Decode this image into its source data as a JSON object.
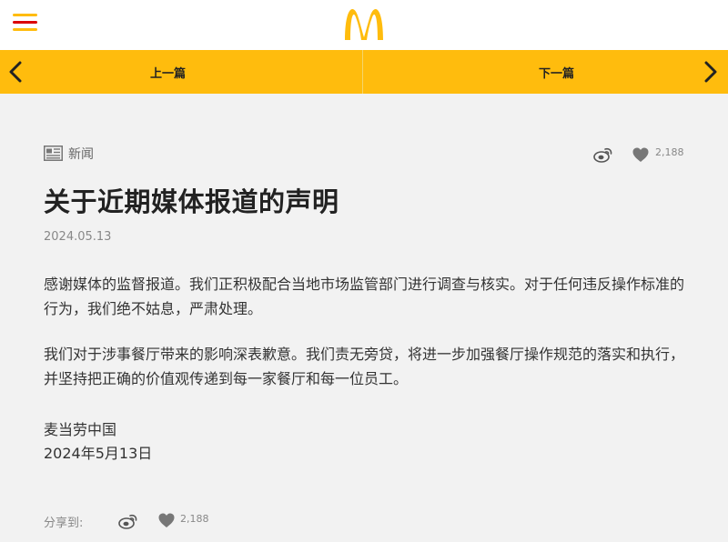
{
  "header": {
    "menu_icon": "hamburger-menu-icon",
    "logo_icon": "mcdonalds-golden-arches-logo",
    "brand_colors": {
      "yellow": "#ffbc0d",
      "red": "#db0007"
    }
  },
  "nav": {
    "prev_label": "上一篇",
    "next_label": "下一篇",
    "prev_icon": "chevron-left-icon",
    "next_icon": "chevron-right-icon"
  },
  "article": {
    "category": "新闻",
    "category_icon": "newspaper-icon",
    "title": "关于近期媒体报道的声明",
    "date": "2024.05.13",
    "paragraphs": [
      "感谢媒体的监督报道。我们正积极配合当地市场监管部门进行调查与核实。对于任何违反操作标准的行为，我们绝不姑息，严肃处理。",
      "我们对于涉事餐厅带来的影响深表歉意。我们责无旁贷，将进一步加强餐厅操作规范的落实和执行，并坚持把正确的价值观传递到每一家餐厅和每一位员工。"
    ],
    "signature": "麦当劳中国",
    "signature_date": "2024年5月13日"
  },
  "share": {
    "label": "分享到:",
    "weibo_icon": "weibo-icon",
    "like_icon": "heart-icon",
    "like_count": "2,188"
  }
}
